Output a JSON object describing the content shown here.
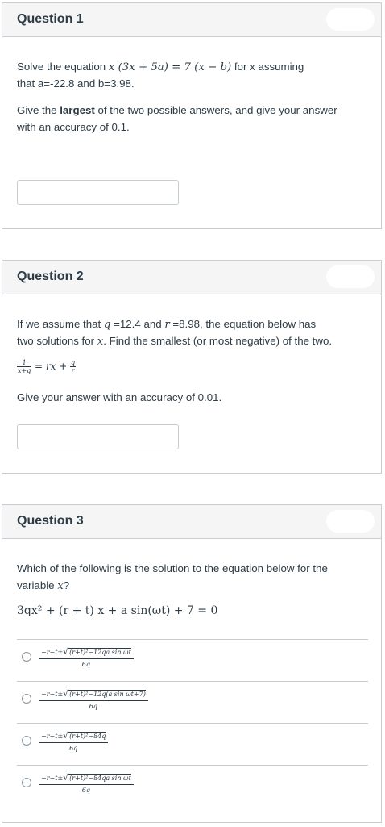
{
  "q1": {
    "title": "Question 1",
    "line1_pre": "Solve the equation ",
    "line1_eq": "x (3x + 5a) = 7 (x − b)",
    "line1_post": " for x assuming",
    "line2": "that a=-22.8 and b=3.98.",
    "line3_pre": "Give the ",
    "line3_bold": "largest",
    "line3_post": " of the two possible answers, and give your answer",
    "line4": "with an accuracy of 0.1."
  },
  "q2": {
    "title": "Question 2",
    "line1_a": "If we assume that ",
    "line1_q": "q",
    "line1_b": " =12.4 and ",
    "line1_r": "r",
    "line1_c": " =8.98, the equation below has",
    "line2_a": "two solutions for ",
    "line2_x": "x",
    "line2_b": ".  Find the smallest (or most negative) of the two.",
    "eq_frac1_num": "1",
    "eq_frac1_den": "x+q",
    "eq_mid": "= rx +",
    "eq_frac2_num": "q",
    "eq_frac2_den": "r",
    "line3": "Give your answer with an accuracy of 0.01."
  },
  "q3": {
    "title": "Question 3",
    "line1": "Which of the following is the solution to the equation below for the",
    "line2_a": "variable ",
    "line2_x": "x",
    "line2_b": "?",
    "equation": "3qx² + (r + t) x + a sin(ωt) + 7  = 0",
    "options": [
      {
        "pre": "−r−t±",
        "rad": "(r+t)²−12qa sin ωt",
        "den": "6q"
      },
      {
        "pre": "−r−t±",
        "rad": "(r+t)²−12q(a sin ωt+7)",
        "den": "6q"
      },
      {
        "pre": "−r−t±",
        "rad": "(r+t)²−84q",
        "den": "6q"
      },
      {
        "pre": "−r−t±",
        "rad": "(r+t)²−84qa sin ωt",
        "den": "6q"
      }
    ]
  }
}
